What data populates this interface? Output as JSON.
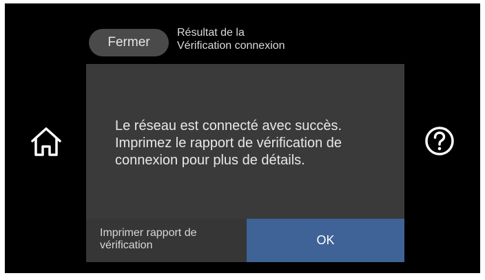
{
  "header": {
    "close_label": "Fermer",
    "title_line1": "Résultat de la",
    "title_line2": "Vérification connexion"
  },
  "dialog": {
    "message_lines": [
      "Le réseau est connecté avec succès.",
      "Imprimez le rapport de vérification de",
      "connexion pour plus de détails."
    ],
    "print_button_line1": "Imprimer rapport de",
    "print_button_line2": "vérification",
    "ok_label": "OK"
  },
  "icons": {
    "home": "home-icon",
    "help": "help-icon"
  },
  "colors": {
    "background": "#000000",
    "dialog": "#3a3a3a",
    "ok_button": "#3f6397",
    "close_button": "#4a4a4a"
  }
}
